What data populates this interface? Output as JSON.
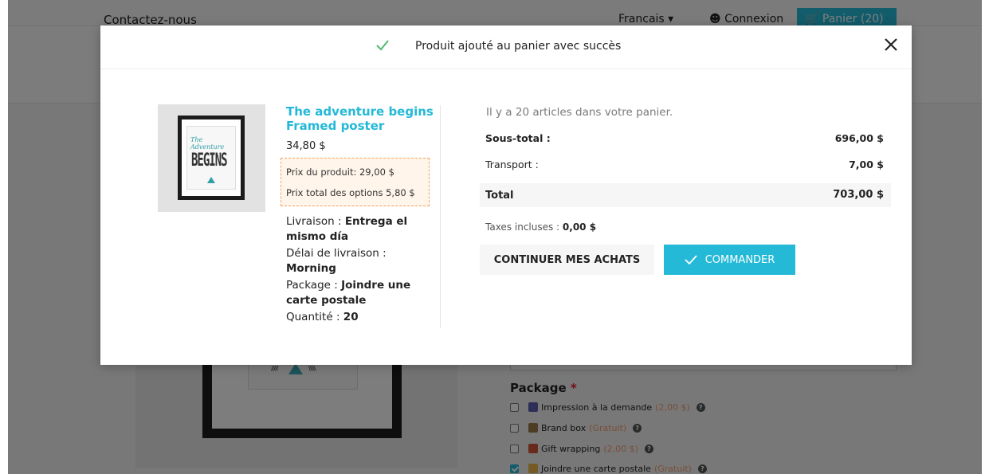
{
  "page": {
    "topbar": {
      "contact": "Contactez-nous",
      "language": "Francais",
      "login": "Connexion",
      "cart": "Panier (20)"
    },
    "package": {
      "title": "Package",
      "required_mark": "*",
      "options": [
        {
          "label": "Impression à la demande",
          "price": "(2,00 $)",
          "checked": false,
          "icon_color": "#5b5fb0"
        },
        {
          "label": "Brand box",
          "price": "(Gratuit)",
          "checked": false,
          "icon_color": "#9a7a4a"
        },
        {
          "label": "Gift wrapping",
          "price": "(2,00 $)",
          "checked": false,
          "icon_color": "#d2543c"
        },
        {
          "label": "Joindre une carte postale",
          "price": "(Gratuit)",
          "checked": true,
          "icon_color": "#e8b64a"
        }
      ],
      "help_glyph": "?"
    }
  },
  "modal": {
    "title": "Produit ajouté au panier avec succès",
    "product": {
      "name": "The adventure begins Framed poster",
      "price": "34,80 $",
      "product_price_line": "Prix du produit: 29,00 $",
      "options_total_line": "Prix total des options 5,80 $",
      "thumb_text_1": "The Adventure",
      "thumb_text_2": "BEGINS",
      "attributes": [
        {
          "label": "Livraison : ",
          "value": "Entrega el mismo día"
        },
        {
          "label": "Délai de livraison : ",
          "value": "Morning"
        },
        {
          "label": "Package : ",
          "value": "Joindre une carte postale"
        },
        {
          "label": "Quantité : ",
          "value": "20"
        }
      ]
    },
    "summary": {
      "count_text": "Il y a 20 articles dans votre panier.",
      "subtotal_label": "Sous-total :",
      "subtotal_value": "696,00 $",
      "shipping_label": "Transport :",
      "shipping_value": "7,00 $",
      "total_label": "Total",
      "total_value": "703,00 $",
      "taxes_label": "Taxes incluses : ",
      "taxes_value": "0,00 $"
    },
    "buttons": {
      "continue": "Continuer mes achats",
      "order": "Commander"
    }
  },
  "colors": {
    "accent": "#24b9d7",
    "success_check": "#4cbb6c",
    "details_border": "#f5a15d"
  }
}
